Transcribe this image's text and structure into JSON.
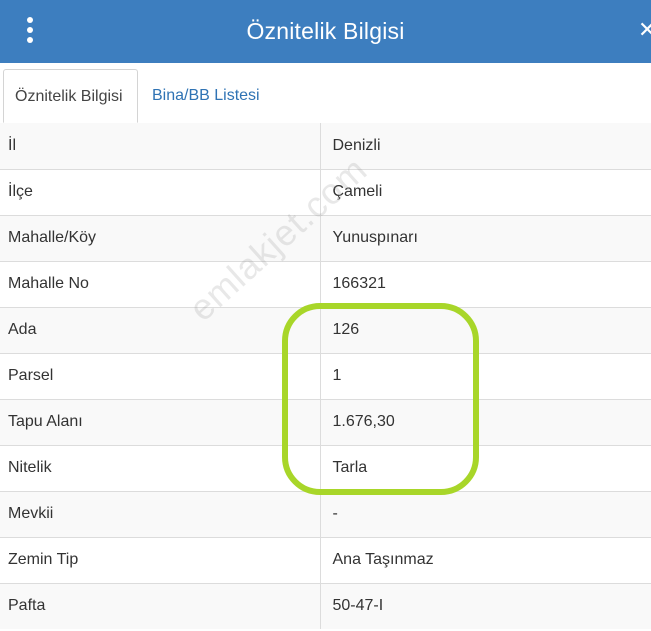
{
  "header": {
    "title": "Öznitelik Bilgisi",
    "close_glyph": "✕"
  },
  "tabs": [
    {
      "label": "Öznitelik Bilgisi",
      "active": true
    },
    {
      "label": "Bina/BB Listesi",
      "active": false
    }
  ],
  "rows": [
    {
      "key": "İl",
      "value": "Denizli"
    },
    {
      "key": "İlçe",
      "value": "Çameli"
    },
    {
      "key": "Mahalle/Köy",
      "value": "Yunuspınarı"
    },
    {
      "key": "Mahalle No",
      "value": "166321"
    },
    {
      "key": "Ada",
      "value": "126"
    },
    {
      "key": "Parsel",
      "value": "1"
    },
    {
      "key": "Tapu Alanı",
      "value": "1.676,30"
    },
    {
      "key": "Nitelik",
      "value": "Tarla"
    },
    {
      "key": "Mevkii",
      "value": "-"
    },
    {
      "key": "Zemin Tip",
      "value": "Ana Taşınmaz"
    },
    {
      "key": "Pafta",
      "value": "50-47-I"
    }
  ],
  "watermark": "emlakjet.com",
  "colors": {
    "header": "#3d7ebf",
    "highlight": "#a8d629",
    "link": "#2f73b4"
  }
}
